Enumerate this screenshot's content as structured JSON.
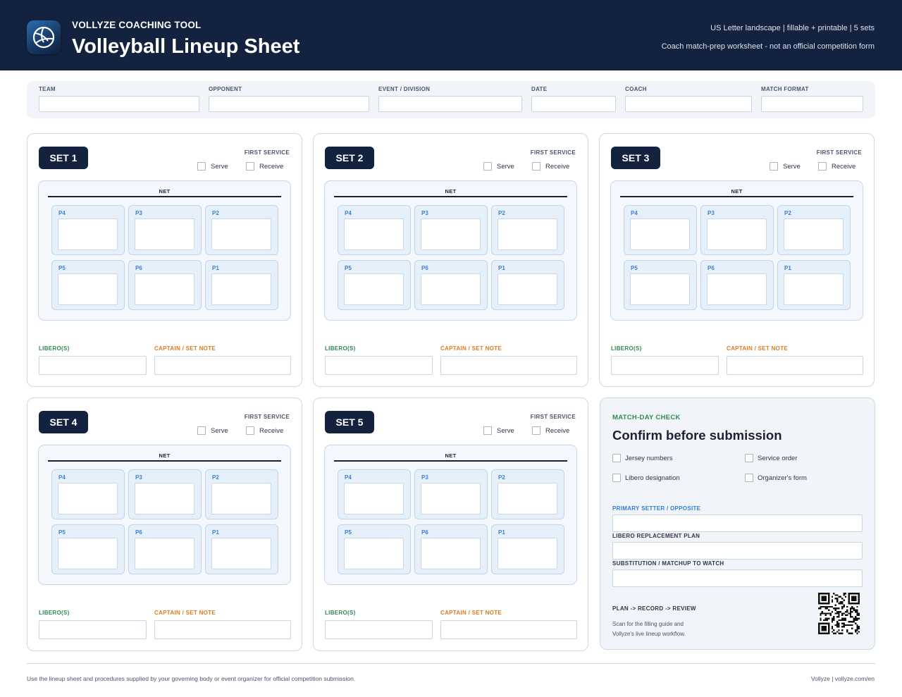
{
  "header": {
    "brand": "VOLLYZE COACHING TOOL",
    "title": "Volleyball Lineup Sheet",
    "meta_line_1": "US Letter landscape | fillable + printable | 5 sets",
    "meta_line_2": "Coach match-prep worksheet - not an official competition form",
    "logo_icon": "volleyball-icon"
  },
  "info_fields": [
    {
      "label": "TEAM"
    },
    {
      "label": "OPPONENT"
    },
    {
      "label": "EVENT / DIVISION"
    },
    {
      "label": "DATE"
    },
    {
      "label": "COACH"
    },
    {
      "label": "MATCH FORMAT"
    }
  ],
  "set_card": {
    "first_service_label": "FIRST SERVICE",
    "serve_label": "Serve",
    "receive_label": "Receive",
    "net_label": "NET",
    "positions_front": [
      "P4",
      "P3",
      "P2"
    ],
    "positions_back": [
      "P5",
      "P6",
      "P1"
    ],
    "libero_label": "LIBERO(S)",
    "captain_label": "CAPTAIN / SET NOTE"
  },
  "sets": [
    {
      "label": "SET 1"
    },
    {
      "label": "SET 2"
    },
    {
      "label": "SET 3"
    },
    {
      "label": "SET 4"
    },
    {
      "label": "SET 5"
    }
  ],
  "check": {
    "eyebrow": "MATCH-DAY CHECK",
    "title": "Confirm before submission",
    "items": [
      "Jersey numbers",
      "Service order",
      "Libero designation",
      "Organizer's form"
    ],
    "fields": [
      {
        "label": "PRIMARY SETTER / OPPOSITE",
        "color": "#2f7fd8"
      },
      {
        "label": "LIBERO REPLACEMENT PLAN",
        "color": "#2d3748"
      },
      {
        "label": "SUBSTITUTION / MATCHUP TO WATCH",
        "color": "#2d3748"
      }
    ],
    "plan": "PLAN -> RECORD -> REVIEW",
    "scan_line_1": "Scan for the filling guide and",
    "scan_line_2": "Vollyze's live lineup workflow.",
    "qr_icon": "qr-code-icon"
  },
  "footer": {
    "left": "Use the lineup sheet and procedures supplied by your governing body or event organizer for official competition submission.",
    "right": "Vollyze | vollyze.com/en"
  },
  "colors": {
    "navy": "#13233f",
    "libero_green": "#2f8a55",
    "captain_orange": "#e07a1c",
    "position_blue": "#3b7fd6"
  }
}
